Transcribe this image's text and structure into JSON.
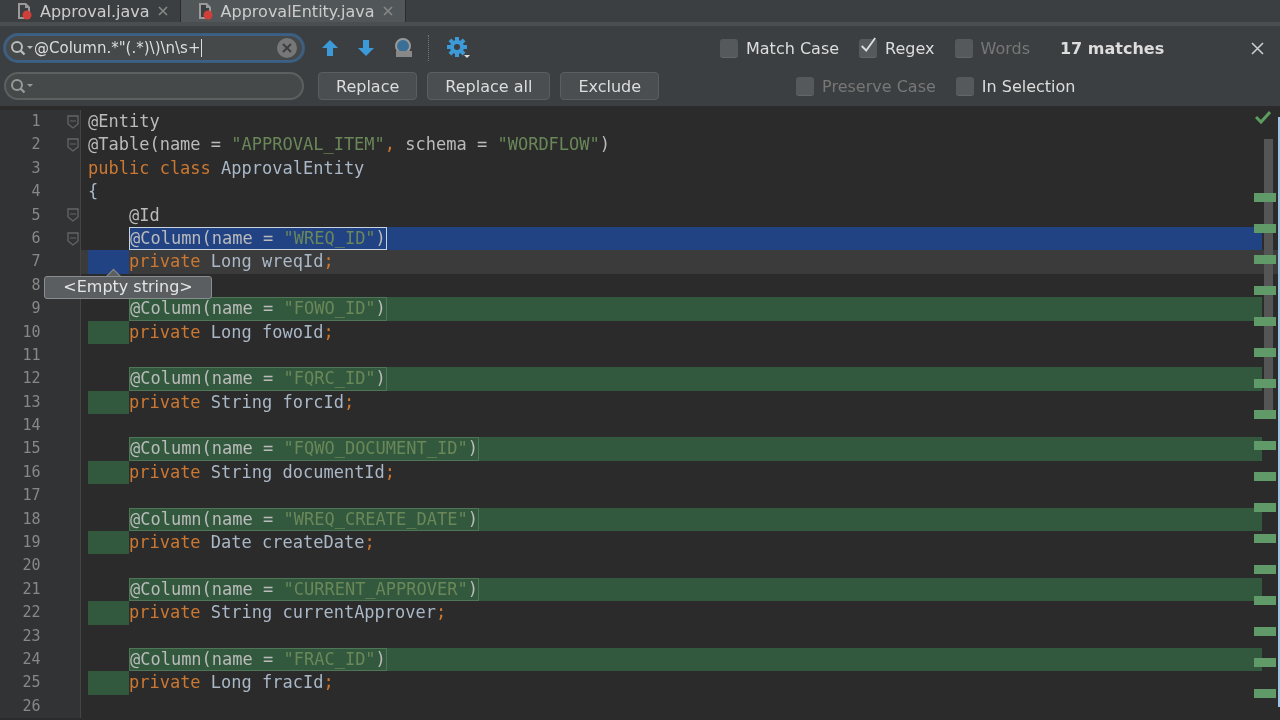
{
  "tabs": [
    {
      "label": "Approval.java",
      "selected": false
    },
    {
      "label": "ApprovalEntity.java",
      "selected": true
    }
  ],
  "find": {
    "query": "@Column.*\"(.*)\\)\\n\\s+",
    "match_count": "17 matches"
  },
  "find_options": [
    {
      "label": "Match Case",
      "checked": false,
      "disabled": false
    },
    {
      "label": "Regex",
      "checked": true,
      "disabled": false
    },
    {
      "label": "Words",
      "checked": false,
      "disabled": true
    }
  ],
  "replace": {
    "buttons": [
      "Replace",
      "Replace all",
      "Exclude"
    ]
  },
  "replace_options": [
    {
      "label": "Preserve Case",
      "checked": false,
      "disabled": true
    },
    {
      "label": "In Selection",
      "checked": false,
      "disabled": false
    }
  ],
  "editor": {
    "tooltip": "<Empty string>",
    "lines": [
      {
        "number": "1",
        "kind": "plain",
        "fold": true,
        "tokens": [
          {
            "kind": "anno",
            "text": "@Entity"
          }
        ]
      },
      {
        "number": "2",
        "kind": "plain",
        "fold": true,
        "tokens": [
          {
            "kind": "anno",
            "text": "@Table(name = "
          },
          {
            "kind": "str",
            "text": "\"APPROVAL_ITEM\""
          },
          {
            "kind": "kw",
            "text": ", "
          },
          {
            "kind": "anno",
            "text": "schema = "
          },
          {
            "kind": "str",
            "text": "\"WORDFLOW\""
          },
          {
            "kind": "anno",
            "text": ")"
          }
        ]
      },
      {
        "number": "3",
        "kind": "plain",
        "tokens": [
          {
            "kind": "kw",
            "text": "public class "
          },
          {
            "kind": "plain",
            "text": "ApprovalEntity"
          }
        ]
      },
      {
        "number": "4",
        "kind": "plain",
        "tokens": [
          {
            "kind": "plain",
            "text": "{"
          }
        ]
      },
      {
        "number": "5",
        "kind": "plain",
        "fold": true,
        "tokens": [
          {
            "kind": "anno",
            "text": "    @Id"
          }
        ]
      },
      {
        "number": "6",
        "fold": true,
        "kind": "selected-start",
        "tokens": [
          {
            "kind": "anno",
            "text": "    @Column(name = "
          },
          {
            "kind": "str",
            "text": "\"WREQ_ID\""
          },
          {
            "kind": "anno",
            "text": ")"
          }
        ]
      },
      {
        "number": "7",
        "current": true,
        "kind": "selected-end",
        "tokens": [
          {
            "kind": "kw",
            "text": "    private "
          },
          {
            "kind": "plain",
            "text": "Long wreqId"
          },
          {
            "kind": "kw",
            "text": ";"
          }
        ]
      },
      {
        "number": "8"
      },
      {
        "number": "9",
        "kind": "found-start",
        "tokens": [
          {
            "kind": "anno",
            "text": "    @Column(name = "
          },
          {
            "kind": "str",
            "text": "\"FOWO_ID\""
          },
          {
            "kind": "anno",
            "text": ")"
          }
        ]
      },
      {
        "number": "10",
        "kind": "found-end",
        "tokens": [
          {
            "kind": "kw",
            "text": "    private "
          },
          {
            "kind": "plain",
            "text": "Long fowoId"
          },
          {
            "kind": "kw",
            "text": ";"
          }
        ]
      },
      {
        "number": "11"
      },
      {
        "number": "12",
        "kind": "found-start",
        "tokens": [
          {
            "kind": "anno",
            "text": "    @Column(name = "
          },
          {
            "kind": "str",
            "text": "\"FQRC_ID\""
          },
          {
            "kind": "anno",
            "text": ")"
          }
        ]
      },
      {
        "number": "13",
        "kind": "found-end",
        "tokens": [
          {
            "kind": "kw",
            "text": "    private "
          },
          {
            "kind": "plain",
            "text": "String forcId"
          },
          {
            "kind": "kw",
            "text": ";"
          }
        ]
      },
      {
        "number": "14"
      },
      {
        "number": "15",
        "kind": "found-start",
        "tokens": [
          {
            "kind": "anno",
            "text": "    @Column(name = "
          },
          {
            "kind": "str",
            "text": "\"FQWO_DOCUMENT_ID\""
          },
          {
            "kind": "anno",
            "text": ")"
          }
        ]
      },
      {
        "number": "16",
        "kind": "found-end",
        "tokens": [
          {
            "kind": "kw",
            "text": "    private "
          },
          {
            "kind": "plain",
            "text": "String documentId"
          },
          {
            "kind": "kw",
            "text": ";"
          }
        ]
      },
      {
        "number": "17"
      },
      {
        "number": "18",
        "kind": "found-start",
        "tokens": [
          {
            "kind": "anno",
            "text": "    @Column(name = "
          },
          {
            "kind": "str",
            "text": "\"WREQ_CREATE_DATE\""
          },
          {
            "kind": "anno",
            "text": ")"
          }
        ]
      },
      {
        "number": "19",
        "kind": "found-end",
        "tokens": [
          {
            "kind": "kw",
            "text": "    private "
          },
          {
            "kind": "plain",
            "text": "Date createDate"
          },
          {
            "kind": "kw",
            "text": ";"
          }
        ]
      },
      {
        "number": "20"
      },
      {
        "number": "21",
        "kind": "found-start",
        "tokens": [
          {
            "kind": "anno",
            "text": "    @Column(name = "
          },
          {
            "kind": "str",
            "text": "\"CURRENT_APPROVER\""
          },
          {
            "kind": "anno",
            "text": ")"
          }
        ]
      },
      {
        "number": "22",
        "kind": "found-end",
        "tokens": [
          {
            "kind": "kw",
            "text": "    private "
          },
          {
            "kind": "plain",
            "text": "String currentApprover"
          },
          {
            "kind": "kw",
            "text": ";"
          }
        ]
      },
      {
        "number": "23"
      },
      {
        "number": "24",
        "kind": "found-start",
        "tokens": [
          {
            "kind": "anno",
            "text": "    @Column(name = "
          },
          {
            "kind": "str",
            "text": "\"FRAC_ID\""
          },
          {
            "kind": "anno",
            "text": ")"
          }
        ]
      },
      {
        "number": "25",
        "kind": "found-end",
        "tokens": [
          {
            "kind": "kw",
            "text": "    private "
          },
          {
            "kind": "plain",
            "text": "Long fracId"
          },
          {
            "kind": "kw",
            "text": ";"
          }
        ]
      },
      {
        "number": "26"
      }
    ]
  }
}
